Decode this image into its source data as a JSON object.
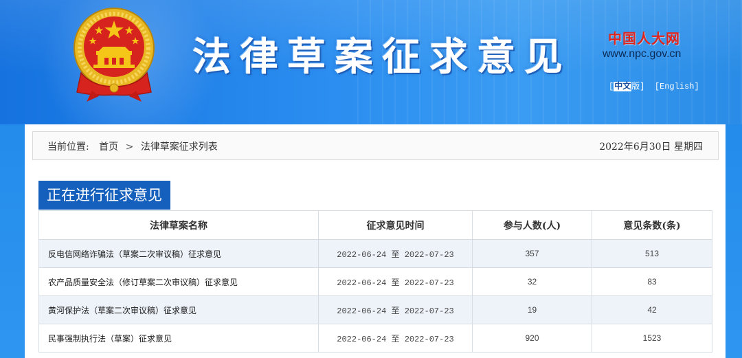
{
  "header": {
    "title": "法律草案征求意见",
    "brand_cn": "中国人大网",
    "brand_url": "www.npc.gov.cn",
    "lang_prefix": "[",
    "lang_cn": "中文",
    "lang_cn_suffix": "版]",
    "lang_en": "[English]"
  },
  "breadcrumb": {
    "prefix": "当前位置:",
    "items": [
      "首页",
      "法律草案征求列表"
    ],
    "separator": ">"
  },
  "date": "2022年6月30日 星期四",
  "section": {
    "title": "正在进行征求意见"
  },
  "table": {
    "columns": [
      "法律草案名称",
      "征求意见时间",
      "参与人数(人)",
      "意见条数(条)"
    ],
    "rows": [
      {
        "name": "反电信网络诈骗法（草案二次审议稿）征求意见",
        "start": "2022-06-24",
        "sep": "至",
        "end": "2022-07-23",
        "participants": "357",
        "opinions": "513"
      },
      {
        "name": "农产品质量安全法（修订草案二次审议稿）征求意见",
        "start": "2022-06-24",
        "sep": "至",
        "end": "2022-07-23",
        "participants": "32",
        "opinions": "83"
      },
      {
        "name": "黄河保护法（草案二次审议稿）征求意见",
        "start": "2022-06-24",
        "sep": "至",
        "end": "2022-07-23",
        "participants": "19",
        "opinions": "42"
      },
      {
        "name": "民事强制执行法（草案）征求意见",
        "start": "2022-06-24",
        "sep": "至",
        "end": "2022-07-23",
        "participants": "920",
        "opinions": "1523"
      }
    ]
  },
  "colors": {
    "banner_blue": "#1f86e8",
    "section_blue": "#1660bd",
    "brand_red": "#e0251e",
    "row_alt": "#eef3fa"
  }
}
